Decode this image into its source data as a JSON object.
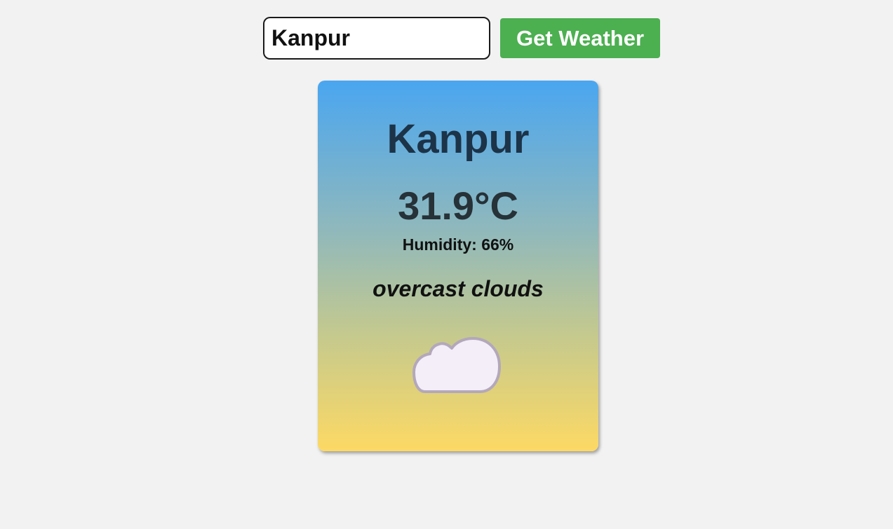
{
  "search": {
    "value": "Kanpur",
    "button_label": "Get Weather"
  },
  "weather": {
    "city": "Kanpur",
    "temperature": "31.9°C",
    "humidity": "Humidity: 66%",
    "description": "overcast clouds",
    "icon": "cloud-icon"
  },
  "colors": {
    "button": "#4caf50",
    "card_gradient_top": "#4aa6f0",
    "card_gradient_bottom": "#fdd964",
    "background": "#f2f2f2"
  }
}
